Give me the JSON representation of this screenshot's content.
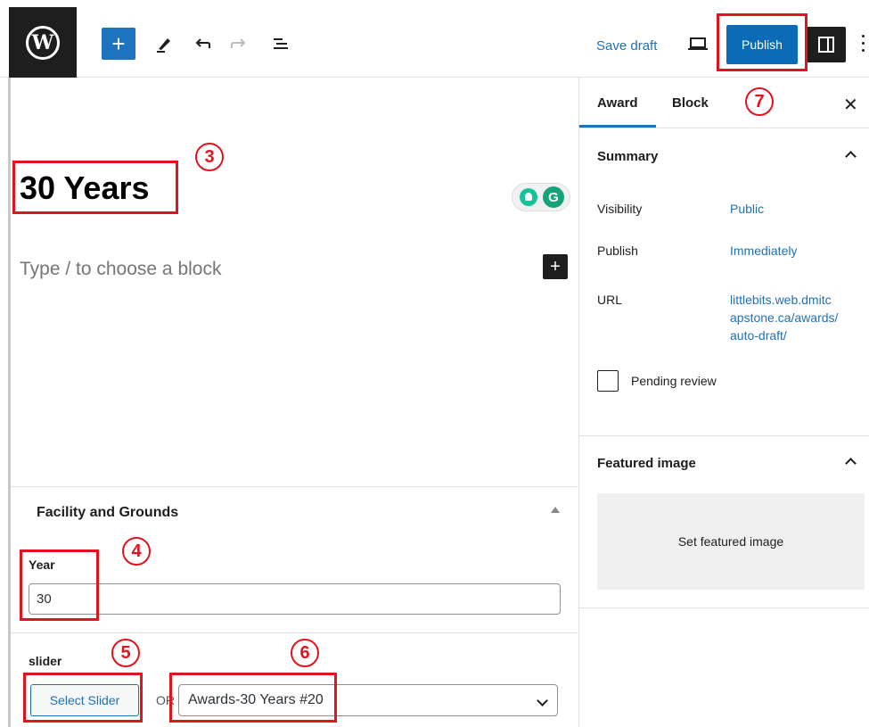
{
  "toolbar": {
    "logo_letter": "W",
    "add_symbol": "+",
    "save_draft_label": "Save draft",
    "publish_label": "Publish"
  },
  "editor": {
    "title": "30 Years",
    "block_placeholder": "Type / to choose a block",
    "grammarly_letter": "G",
    "inline_add_symbol": "+"
  },
  "metabox": {
    "title": "Facility and Grounds",
    "year_label": "Year",
    "year_value": "30",
    "slider_label": "slider",
    "select_slider_label": "Select Slider",
    "or_text": "OR",
    "slider_selected": "Awards-30 Years #20"
  },
  "sidebar": {
    "tabs": [
      {
        "label": "Award",
        "active": true
      },
      {
        "label": "Block",
        "active": false
      }
    ],
    "close_symbol": "✕",
    "summary_title": "Summary",
    "rows": [
      {
        "label": "Visibility",
        "value": "Public"
      },
      {
        "label": "Publish",
        "value": "Immediately"
      },
      {
        "label": "URL",
        "value_lines": [
          "littlebits.web.dmitc",
          "apstone.ca/awards/",
          "auto-draft/"
        ]
      }
    ],
    "pending_review_label": "Pending review",
    "featured_image_title": "Featured image",
    "set_featured_label": "Set featured image"
  },
  "annotations": [
    "3",
    "4",
    "5",
    "6",
    "7"
  ],
  "colors": {
    "accent": "#2271b1",
    "publish_bg": "#0a6bb6",
    "annotation_red": "#e0141e",
    "dark": "#1e1e1e"
  },
  "icons": [
    "wordpress-logo-icon",
    "plus-icon",
    "pen-icon",
    "undo-icon",
    "redo-icon",
    "list-view-icon",
    "preview-icon",
    "settings-panel-icon",
    "options-icon",
    "close-icon",
    "chevron-up-icon",
    "chevron-down-icon",
    "grammarly-icon"
  ]
}
